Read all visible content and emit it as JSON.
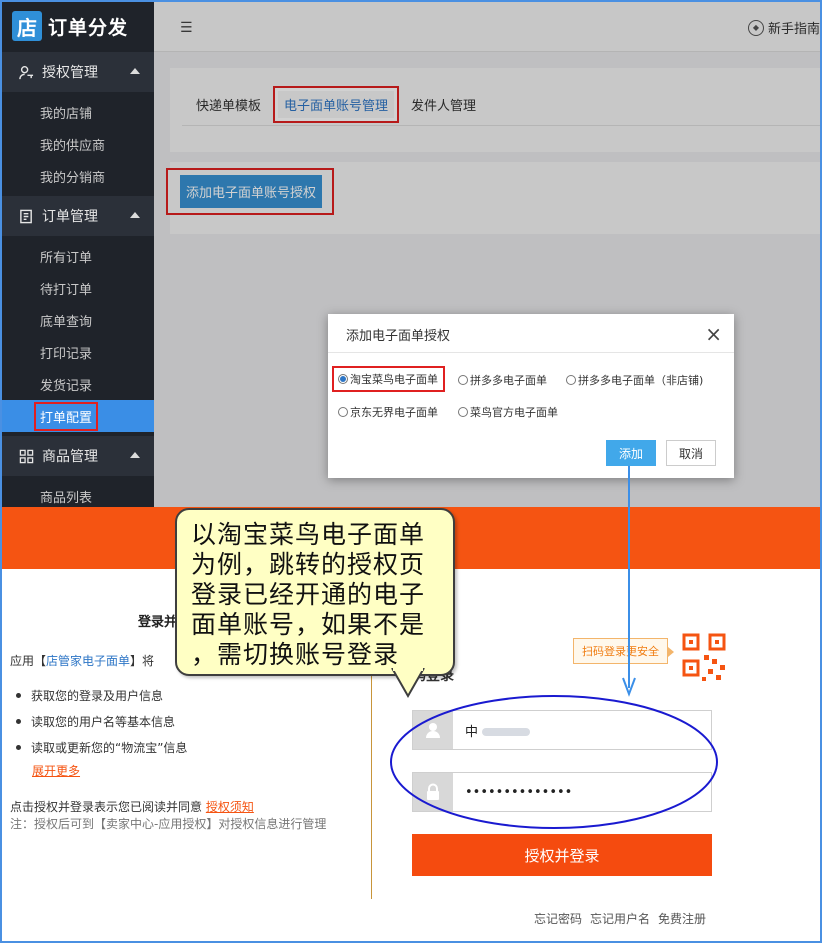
{
  "brand": {
    "icon_char": "店",
    "title": "订单分发"
  },
  "sidebar": {
    "groups": [
      {
        "label": "授权管理",
        "items": [
          "我的店铺",
          "我的供应商",
          "我的分销商"
        ]
      },
      {
        "label": "订单管理",
        "items": [
          "所有订单",
          "待打订单",
          "底单查询",
          "打印记录",
          "发货记录",
          "打单配置"
        ]
      },
      {
        "label": "商品管理",
        "items": [
          "商品列表"
        ]
      }
    ],
    "active_item": "打单配置"
  },
  "topbar": {
    "collapse_icon": "☰",
    "guide_label": "新手指南"
  },
  "tabs": [
    "快递单模板",
    "电子面单账号管理",
    "发件人管理"
  ],
  "selected_tab": "电子面单账号管理",
  "add_button_label": "添加电子面单账号授权",
  "dialog": {
    "title": "添加电子面单授权",
    "close": "×",
    "options": [
      {
        "label": "淘宝菜鸟电子面单",
        "checked": true
      },
      {
        "label": "拼多多电子面单",
        "checked": false
      },
      {
        "label": "拼多多电子面单（非店铺)",
        "checked": false
      },
      {
        "label": "京东无界电子面单",
        "checked": false
      },
      {
        "label": "菜鸟官方电子面单",
        "checked": false
      }
    ],
    "ok_label": "添加",
    "cancel_label": "取消"
  },
  "auth": {
    "heading": "登录并",
    "app_prefix": "应用【",
    "app_name": "店管家电子面单",
    "app_suffix": "】将",
    "permissions": [
      "获取您的登录及用户信息",
      "读取您的用户名等基本信息",
      "读取或更新您的“物流宝”信息"
    ],
    "expand_label": "展开更多",
    "agree_prefix": "点击授权并登录表示您已阅读并同意",
    "agree_link": "授权须知",
    "note": "注：授权后可到【卖家中心-应用授权】对授权信息进行管理",
    "scan_tip": "扫码登录更安全",
    "password_login_title": "码登录",
    "username_value": "中",
    "password_value": "••••••••••••••",
    "submit_label": "授权并登录",
    "footer_links": [
      "忘记密码",
      "忘记用户名",
      "免费注册"
    ]
  },
  "annotation": {
    "text": "以淘宝菜鸟电子面单\n为例，跳转的授权页\n登录已经开通的电子\n面单账号，如果不是\n，需切换账号登录"
  },
  "colors": {
    "sidebar_bg": "#1f232a",
    "accent_blue": "#3892d3",
    "taobao_orange": "#f55412",
    "highlight_red": "#e02020",
    "callout_bg": "#ffffc4"
  }
}
